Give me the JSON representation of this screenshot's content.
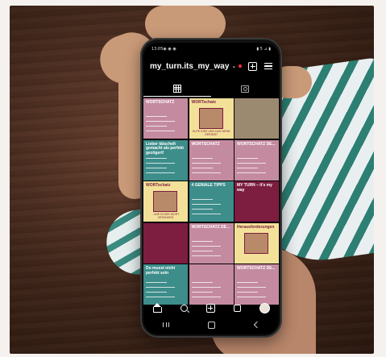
{
  "status": {
    "time": "13:05",
    "icons": "◉ ◉ ◉",
    "right": "▮ 5 ⊿ ▮"
  },
  "profile": {
    "username": "my_turn.its_my_way",
    "chevron": "⌄"
  },
  "grid_tiles": [
    {
      "style": "t-pink",
      "title": "WORTSCHATZ",
      "dark": false
    },
    {
      "style": "t-yel",
      "title": "WORTschatz",
      "caption": "GUTE IDEE UND DAS NEHM GERADE!",
      "dark": true
    },
    {
      "style": "t-photo",
      "title": "",
      "dark": false
    },
    {
      "style": "t-teal",
      "title": "Lieber tätschelt gemacht als perfekt gezögert!",
      "dark": false
    },
    {
      "style": "t-pink",
      "title": "WORTSCHATZ",
      "dark": false
    },
    {
      "style": "t-pink",
      "title": "WORTSCHATZ DE...",
      "dark": false
    },
    {
      "style": "t-yel",
      "title": "WORTschatz",
      "caption": "...WIE IN DER WORT GEFANGEN",
      "dark": true
    },
    {
      "style": "t-teal",
      "title": "4 GENIALE TIPPS",
      "dark": false
    },
    {
      "style": "t-plum",
      "title": "MY TURN – it's my way",
      "dark": false
    },
    {
      "style": "t-plum",
      "title": "",
      "dark": false
    },
    {
      "style": "t-pink",
      "title": "WORTSCHATZ DE...",
      "dark": false
    },
    {
      "style": "t-yel",
      "title": "Herausforderungen",
      "dark": true
    },
    {
      "style": "t-teal",
      "title": "Du musst nicht perfekt sein",
      "dark": false
    },
    {
      "style": "t-pink",
      "title": "",
      "dark": false
    },
    {
      "style": "t-pink",
      "title": "WORTSCHATZ DE...",
      "dark": false
    }
  ]
}
